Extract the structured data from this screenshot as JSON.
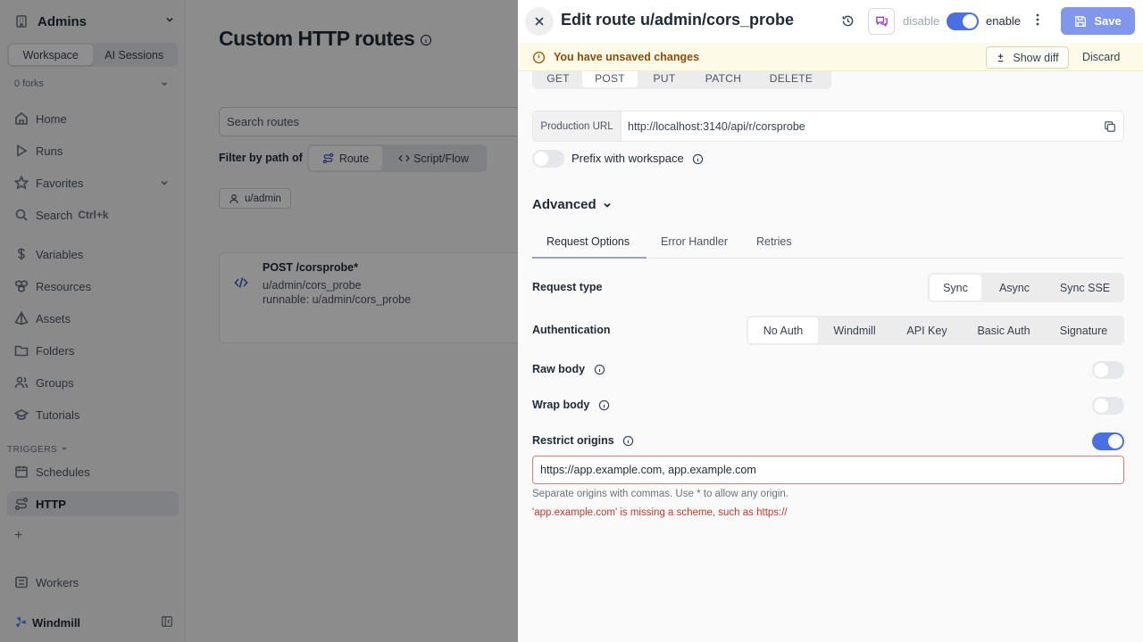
{
  "sidebar": {
    "workspace": "Admins",
    "seg": [
      "Workspace",
      "AI Sessions"
    ],
    "forks": "0 forks",
    "nav": [
      {
        "label": "Home",
        "icon": "home-icon"
      },
      {
        "label": "Runs",
        "icon": "play-icon"
      },
      {
        "label": "Favorites",
        "icon": "star-icon"
      },
      {
        "label": "Search",
        "icon": "search-icon",
        "kbd": "Ctrl+k"
      },
      {
        "label": "Variables",
        "icon": "dollar-icon"
      },
      {
        "label": "Resources",
        "icon": "boxes-icon"
      },
      {
        "label": "Assets",
        "icon": "pyramid-icon"
      },
      {
        "label": "Folders",
        "icon": "folder-icon"
      },
      {
        "label": "Groups",
        "icon": "users-icon"
      },
      {
        "label": "Tutorials",
        "icon": "graduation-cap-icon"
      }
    ],
    "triggers_label": "TRIGGERS",
    "triggers": [
      {
        "label": "Schedules",
        "icon": "calendar-icon"
      },
      {
        "label": "HTTP",
        "icon": "route-icon",
        "active": true
      }
    ],
    "workers": "Workers",
    "brand": "Windmill"
  },
  "main": {
    "title": "Custom HTTP routes",
    "search_placeholder": "Search routes",
    "filter_label": "Filter by path of",
    "filter_options": [
      "Route",
      "Script/Flow"
    ],
    "owner_chip": "u/admin",
    "card": {
      "title": "POST /corsprobe*",
      "path": "u/admin/cors_probe",
      "runnable": "runnable: u/admin/cors_probe"
    }
  },
  "drawer": {
    "title": "Edit route u/admin/cors_probe",
    "disable_label": "disable",
    "enable_label": "enable",
    "save_label": "Save",
    "unsaved": "You have unsaved changes",
    "show_diff": "Show diff",
    "discard": "Discard",
    "methods": [
      "GET",
      "POST",
      "PUT",
      "PATCH",
      "DELETE"
    ],
    "selected_method": "POST",
    "url_label": "Production URL",
    "url_value": "http://localhost:3140/api/r/corsprobe",
    "prefix_label": "Prefix with workspace",
    "advanced": "Advanced",
    "tabs": [
      "Request Options",
      "Error Handler",
      "Retries"
    ],
    "request_type_label": "Request type",
    "request_types": [
      "Sync",
      "Async",
      "Sync SSE"
    ],
    "auth_label": "Authentication",
    "auth_options": [
      "No Auth",
      "Windmill",
      "API Key",
      "Basic Auth",
      "Signature"
    ],
    "raw_body": "Raw body",
    "wrap_body": "Wrap body",
    "restrict_origins": "Restrict origins",
    "origins_value": "https://app.example.com, app.example.com",
    "origins_hint": "Separate origins with commas. Use * to allow any origin.",
    "origins_error": "'app.example.com' is missing a scheme, such as https://"
  },
  "colors": {
    "accent": "#4a6fe2",
    "error": "#c0392b",
    "warn_bg": "#fefae8"
  }
}
